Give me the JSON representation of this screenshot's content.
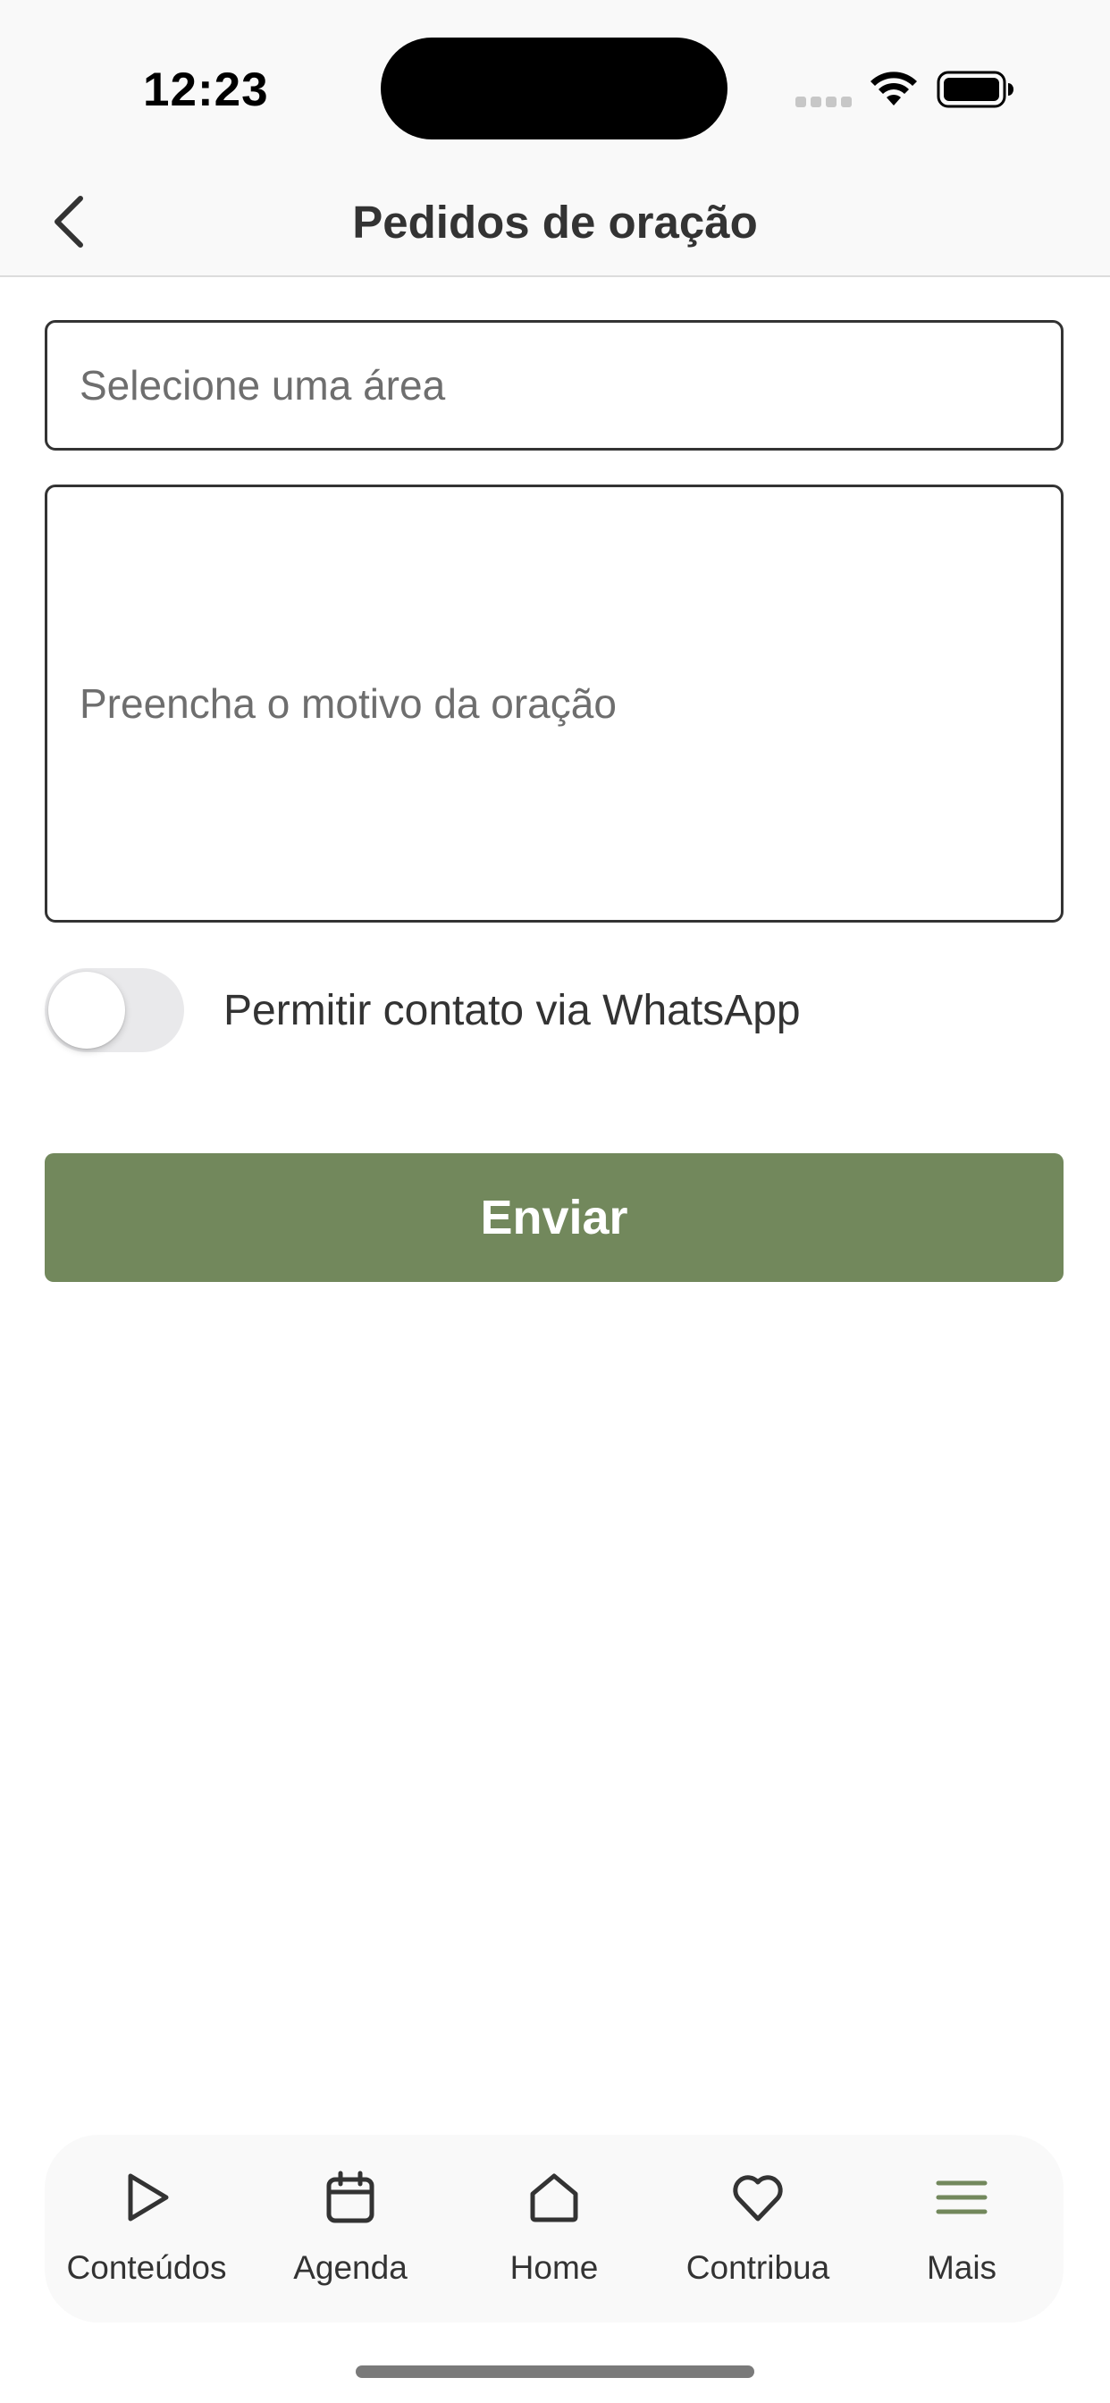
{
  "status_bar": {
    "time": "12:23"
  },
  "nav": {
    "title": "Pedidos de oração",
    "back_icon": "chevron-left-icon"
  },
  "form": {
    "area_select_placeholder": "Selecione uma área",
    "reason_placeholder": "Preencha o motivo da oração",
    "whatsapp_toggle_label": "Permitir contato via WhatsApp",
    "whatsapp_toggle_on": false,
    "send_label": "Enviar"
  },
  "tabs": [
    {
      "label": "Conteúdos",
      "icon": "play-icon"
    },
    {
      "label": "Agenda",
      "icon": "calendar-icon"
    },
    {
      "label": "Home",
      "icon": "home-icon"
    },
    {
      "label": "Contribua",
      "icon": "heart-icon"
    },
    {
      "label": "Mais",
      "icon": "menu-icon",
      "active": true
    }
  ],
  "colors": {
    "accent": "#72885c",
    "text": "#333333",
    "placeholder": "#6e6e6e",
    "bar_background": "#f9f9f9"
  }
}
